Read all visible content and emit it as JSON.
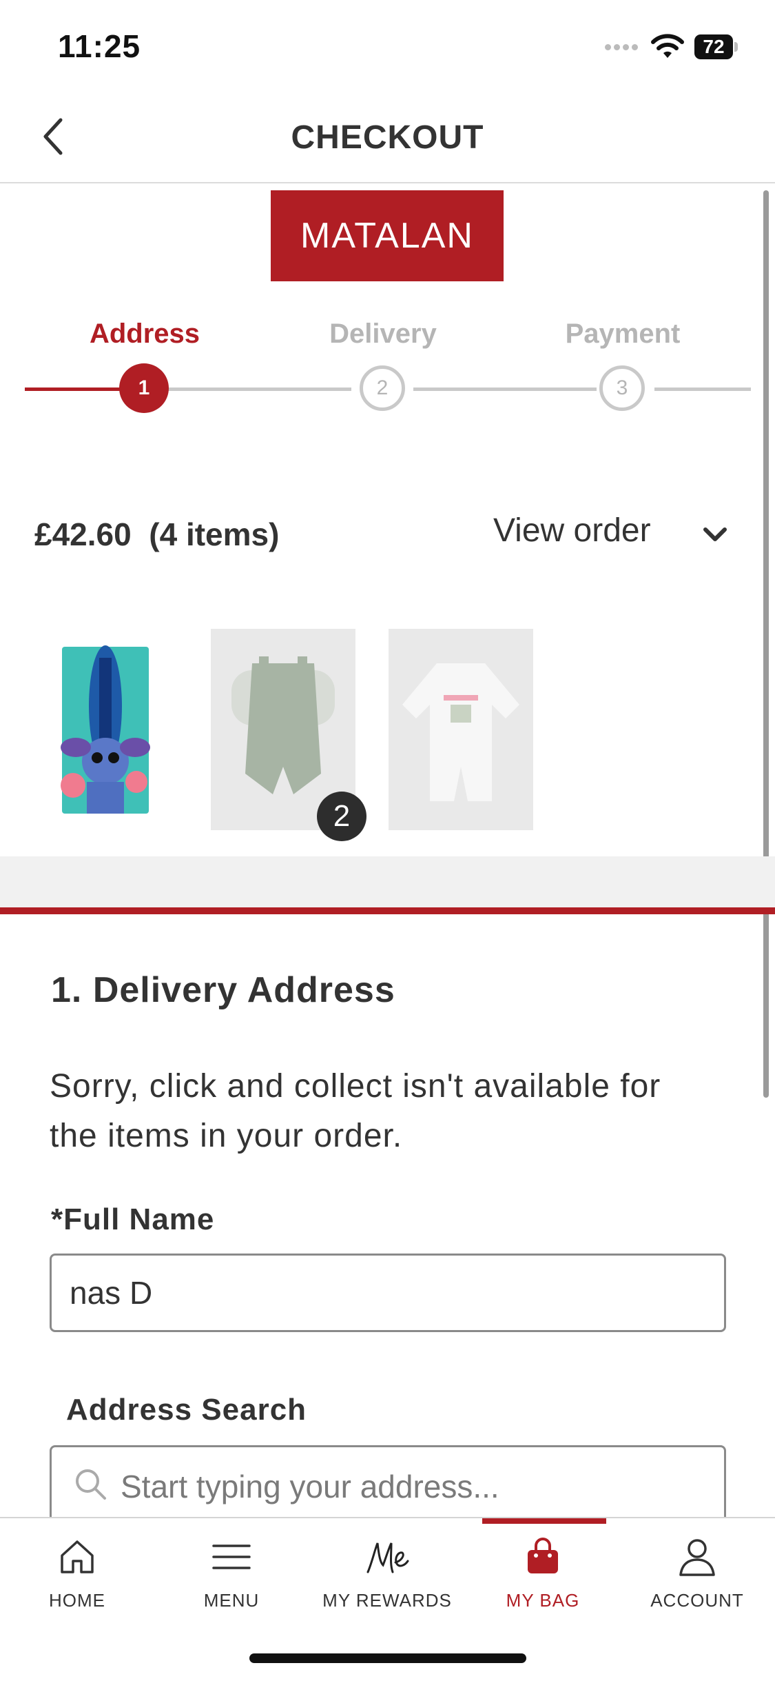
{
  "status_bar": {
    "time": "11:25",
    "battery": "72"
  },
  "header": {
    "title": "CHECKOUT"
  },
  "brand": {
    "logo_text": "MATALAN",
    "color": "#b01e24"
  },
  "stepper": {
    "steps": [
      {
        "label": "Address",
        "number": "1",
        "state": "active"
      },
      {
        "label": "Delivery",
        "number": "2",
        "state": "inactive"
      },
      {
        "label": "Payment",
        "number": "3",
        "state": "inactive"
      }
    ]
  },
  "order": {
    "total": "£42.60",
    "items": "(4 items)",
    "view_label": "View order",
    "thumbnails": [
      "stitch-towel",
      "green-dungarees-set",
      "white-sleepsuit"
    ],
    "quantity_badge": "2"
  },
  "form": {
    "section_title": "1. Delivery Address",
    "notice": "Sorry, click and collect isn't available for the items in your order.",
    "full_name_label": "*Full Name",
    "full_name_value": "nas D",
    "address_search_label": "Address Search",
    "address_search_placeholder": "Start typing your address..."
  },
  "tabbar": {
    "tabs": [
      {
        "label": "HOME",
        "icon": "home-icon"
      },
      {
        "label": "MENU",
        "icon": "menu-icon"
      },
      {
        "label": "MY REWARDS",
        "icon": "me-rewards-icon"
      },
      {
        "label": "MY BAG",
        "icon": "bag-icon",
        "active": true
      },
      {
        "label": "ACCOUNT",
        "icon": "account-icon"
      }
    ]
  }
}
